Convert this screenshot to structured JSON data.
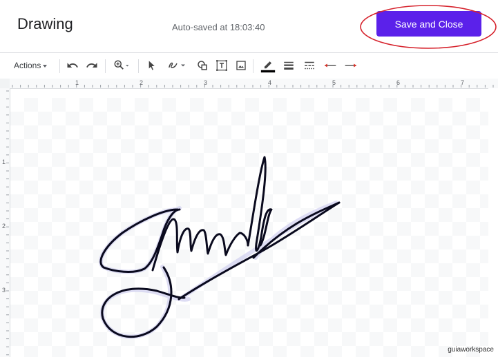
{
  "header": {
    "title": "Drawing",
    "autosave": "Auto-saved at 18:03:40",
    "save_label": "Save and Close"
  },
  "toolbar": {
    "actions_label": "Actions",
    "tools": [
      "undo-icon",
      "redo-icon",
      "zoom-icon",
      "select-icon",
      "line-icon",
      "shape-icon",
      "text-box-icon",
      "image-icon",
      "pen-color-icon",
      "line-weight-icon",
      "line-dash-icon",
      "line-start-icon",
      "line-end-icon"
    ]
  },
  "ruler": {
    "horizontal_labels": [
      "1",
      "2",
      "3",
      "4",
      "5",
      "6",
      "7"
    ],
    "vertical_labels": [
      "1",
      "2",
      "3"
    ]
  },
  "colors": {
    "save_button": "#5b21ea",
    "highlight_ring": "#d6222c",
    "stroke": "#0a0a1e"
  },
  "watermark": "guiaworkspace"
}
